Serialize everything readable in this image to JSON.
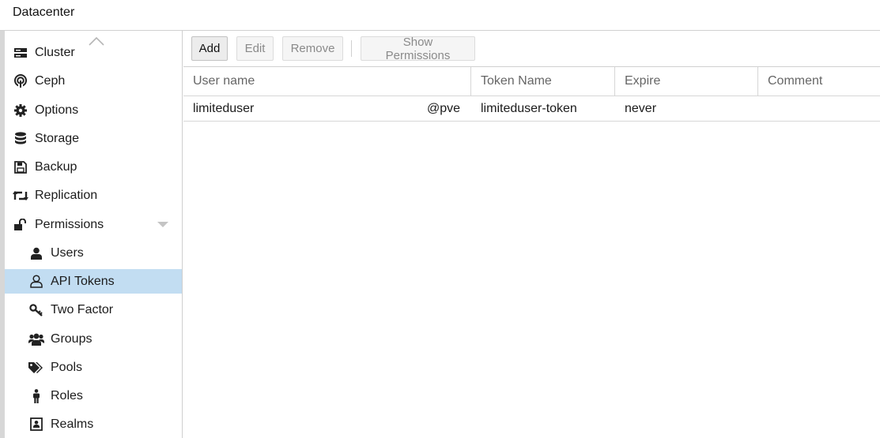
{
  "header": {
    "title": "Datacenter"
  },
  "sidebar": {
    "items": [
      {
        "label": "Cluster",
        "icon": "server-icon"
      },
      {
        "label": "Ceph",
        "icon": "ceph-icon"
      },
      {
        "label": "Options",
        "icon": "gear-icon"
      },
      {
        "label": "Storage",
        "icon": "database-icon"
      },
      {
        "label": "Backup",
        "icon": "floppy-icon"
      },
      {
        "label": "Replication",
        "icon": "retweet-icon"
      },
      {
        "label": "Permissions",
        "icon": "unlock-icon"
      },
      {
        "label": "Users",
        "icon": "user-icon"
      },
      {
        "label": "API Tokens",
        "icon": "user-outline-icon",
        "selected": true
      },
      {
        "label": "Two Factor",
        "icon": "key-icon"
      },
      {
        "label": "Groups",
        "icon": "users-icon"
      },
      {
        "label": "Pools",
        "icon": "tags-icon"
      },
      {
        "label": "Roles",
        "icon": "male-icon"
      },
      {
        "label": "Realms",
        "icon": "address-book-icon"
      }
    ],
    "selected_color": "#c2ddf2"
  },
  "toolbar": {
    "add_label": "Add",
    "edit_label": "Edit",
    "remove_label": "Remove",
    "show_permissions_label": "Show Permissions"
  },
  "grid": {
    "columns": [
      "User name",
      "Token Name",
      "Expire",
      "Comment"
    ],
    "rows": [
      {
        "user": "limiteduser",
        "realm": "@pve",
        "token": "limiteduser-token",
        "expire": "never",
        "comment": ""
      }
    ]
  }
}
